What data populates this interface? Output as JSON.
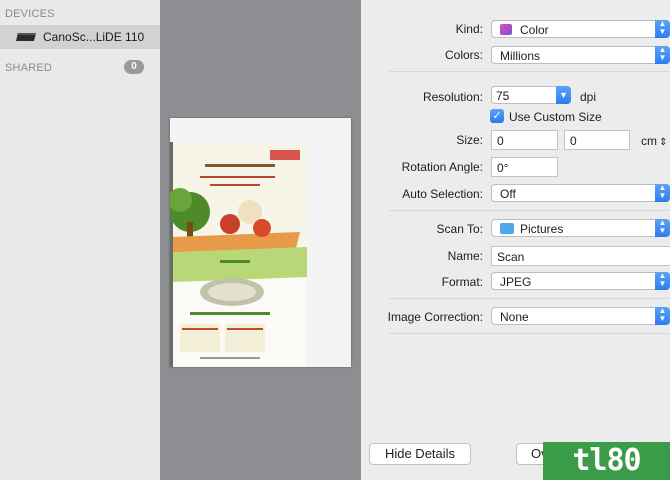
{
  "sidebar": {
    "devices_header": "DEVICES",
    "device_name": "CanoSc...LiDE 110",
    "shared_header": "SHARED",
    "shared_count": "0"
  },
  "settings": {
    "kind_label": "Kind:",
    "kind_value": "Color",
    "colors_label": "Colors:",
    "colors_value": "Millions",
    "resolution_label": "Resolution:",
    "resolution_value": "75",
    "resolution_unit": "dpi",
    "custom_size_label": "Use Custom Size",
    "custom_size_checked": true,
    "size_label": "Size:",
    "size_width": "0",
    "size_height": "0",
    "size_unit": "cm",
    "rotation_label": "Rotation Angle:",
    "rotation_value": "0°",
    "auto_selection_label": "Auto Selection:",
    "auto_selection_value": "Off",
    "scan_to_label": "Scan To:",
    "scan_to_value": "Pictures",
    "name_label": "Name:",
    "name_value": "Scan",
    "format_label": "Format:",
    "format_value": "JPEG",
    "image_correction_label": "Image Correction:",
    "image_correction_value": "None"
  },
  "buttons": {
    "hide_details": "Hide Details",
    "overview": "Ove"
  },
  "watermark": "tl80",
  "colors": {
    "accent": "#2b7cf1",
    "watermark": "#3a9b48"
  }
}
